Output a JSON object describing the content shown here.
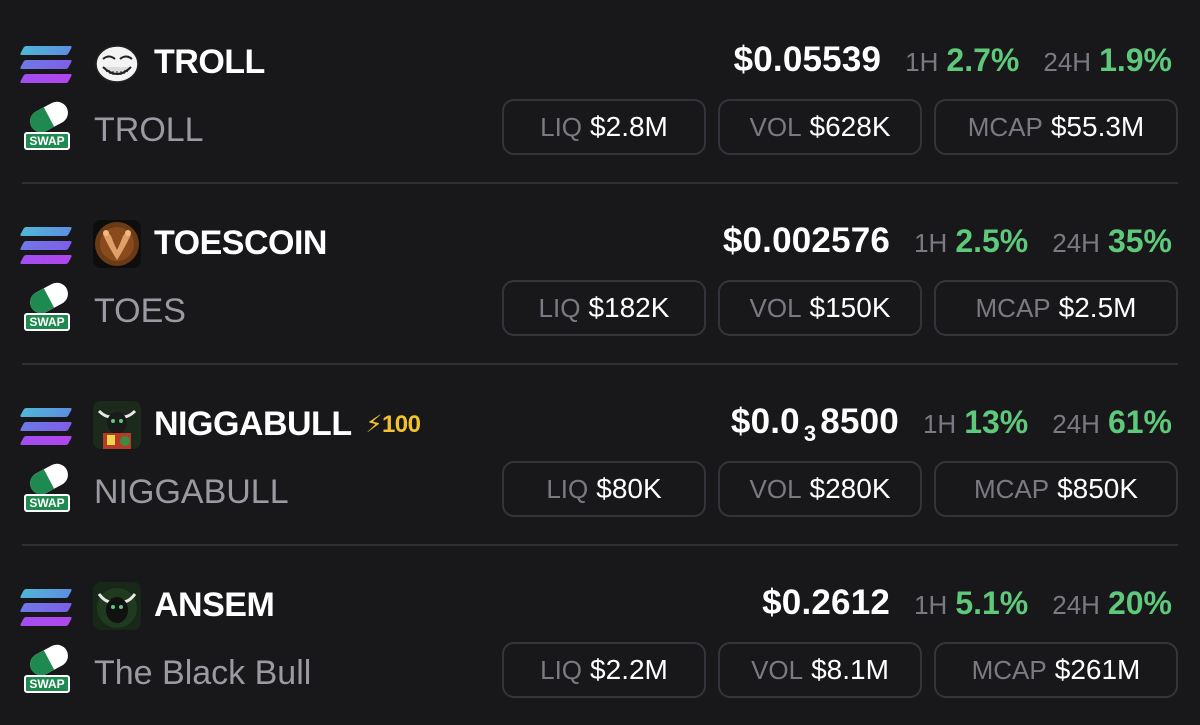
{
  "labels": {
    "h1": "1H",
    "h24": "24H",
    "liq": "LIQ",
    "vol": "VOL",
    "mcap": "MCAP",
    "swap": "SWAP"
  },
  "colors": {
    "positive": "#5ec97a",
    "boost": "#f2c12e",
    "background": "#18181b"
  },
  "tokens": [
    {
      "name": "TROLL",
      "symbol": "TROLL",
      "avatar": "troll-face-avatar",
      "price_main": "$0.05539",
      "price_sub": "",
      "price_tail": "",
      "change_1h": "2.7%",
      "change_24h": "1.9%",
      "liq": "$2.8M",
      "vol": "$628K",
      "mcap": "$55.3M",
      "boost": ""
    },
    {
      "name": "TOESCOIN",
      "symbol": "TOES",
      "avatar": "toes-avatar",
      "price_main": "$0.002576",
      "price_sub": "",
      "price_tail": "",
      "change_1h": "2.5%",
      "change_24h": "35%",
      "liq": "$182K",
      "vol": "$150K",
      "mcap": "$2.5M",
      "boost": ""
    },
    {
      "name": "NIGGABULL",
      "symbol": "NIGGABULL",
      "avatar": "bull-avatar",
      "price_main": "$0.0",
      "price_sub": "3",
      "price_tail": "8500",
      "change_1h": "13%",
      "change_24h": "61%",
      "liq": "$80K",
      "vol": "$280K",
      "mcap": "$850K",
      "boost": "⚡100"
    },
    {
      "name": "ANSEM",
      "symbol": "The Black Bull",
      "avatar": "black-bull-avatar",
      "price_main": "$0.2612",
      "price_sub": "",
      "price_tail": "",
      "change_1h": "5.1%",
      "change_24h": "20%",
      "liq": "$2.2M",
      "vol": "$8.1M",
      "mcap": "$261M",
      "boost": ""
    }
  ]
}
